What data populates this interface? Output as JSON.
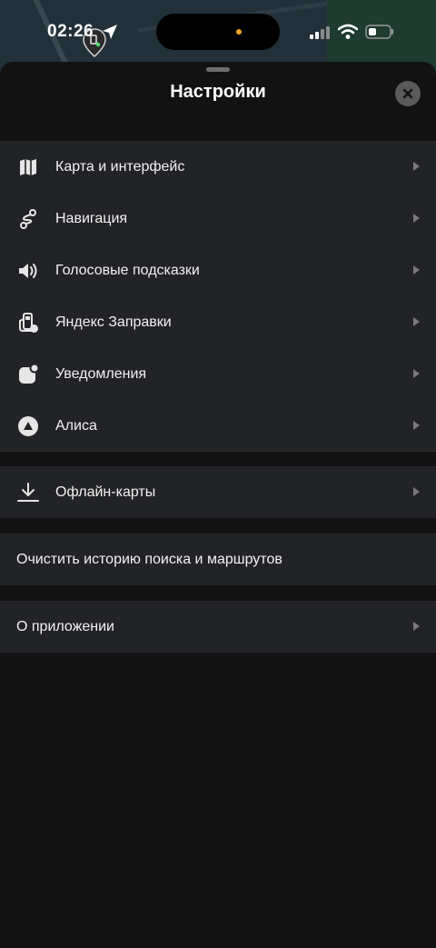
{
  "status_bar": {
    "time": "02:26"
  },
  "sheet": {
    "title": "Настройки"
  },
  "groups": [
    {
      "items": [
        {
          "label": "Карта и интерфейс",
          "icon": "map-icon"
        },
        {
          "label": "Навигация",
          "icon": "route-icon"
        },
        {
          "label": "Голосовые подсказки",
          "icon": "speaker-icon"
        },
        {
          "label": "Яндекс Заправки",
          "icon": "fuel-icon"
        },
        {
          "label": "Уведомления",
          "icon": "notification-icon"
        },
        {
          "label": "Алиса",
          "icon": "alice-icon"
        }
      ]
    },
    {
      "items": [
        {
          "label": "Офлайн-карты",
          "icon": "download-icon"
        }
      ]
    },
    {
      "items": [
        {
          "label": "Очистить историю поиска и маршрутов"
        }
      ]
    },
    {
      "items": [
        {
          "label": "О приложении"
        }
      ]
    }
  ],
  "colors": {
    "sheet_bg": "#121212",
    "row_bg": "#222326",
    "close_bg": "#5a5a5a",
    "accent_dot": "#f5a623"
  }
}
